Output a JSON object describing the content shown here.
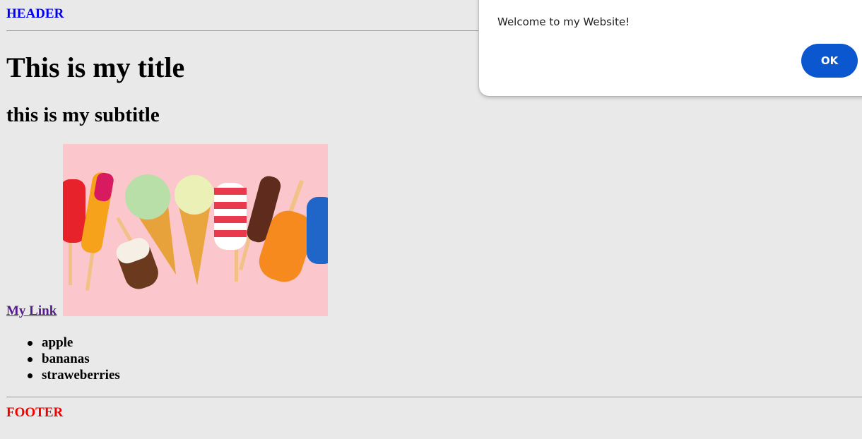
{
  "page": {
    "header": "HEADER",
    "title": "This is my title",
    "subtitle": "this is my subtitle",
    "link_text": "My Link",
    "image_alt": "ice cream and popsicles on pink background",
    "list": [
      "apple",
      "bananas",
      "straweberries"
    ],
    "footer": "FOOTER"
  },
  "dialog": {
    "origin": "trustseal-unique",
    "message": "Welcome to my Website!",
    "ok_label": "OK"
  },
  "colors": {
    "background": "#e9e9e9",
    "header": "#0000ee",
    "footer": "#ee0000",
    "link": "#551a8b",
    "ok_button": "#0b57d0"
  }
}
